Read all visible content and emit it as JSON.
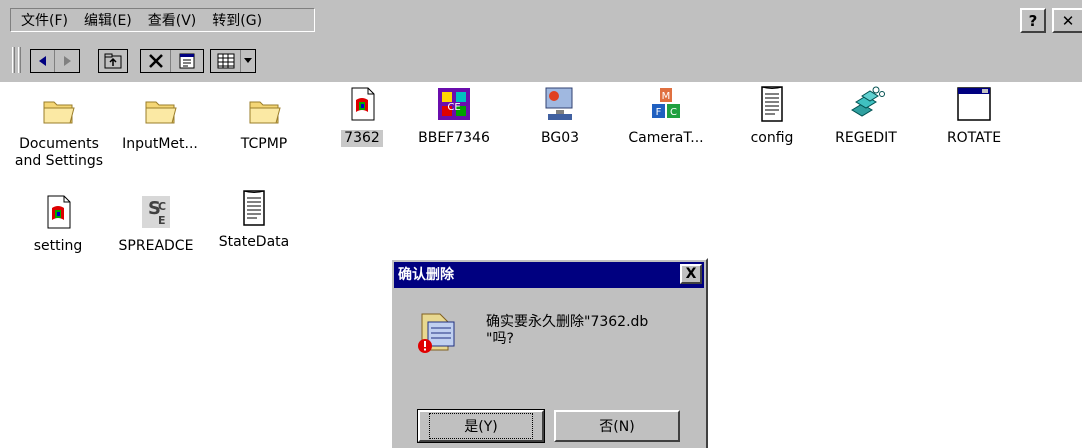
{
  "menubar": {
    "items": [
      "文件(F)",
      "编辑(E)",
      "查看(V)",
      "转到(G)"
    ],
    "help_label": "?",
    "close_label": "✕"
  },
  "toolbar": {
    "buttons": [
      "back-icon",
      "forward-icon",
      "up-folder-icon",
      "delete-icon",
      "properties-icon",
      "view-menu-icon"
    ]
  },
  "icons": [
    {
      "label": "Documents and Settings",
      "icon": "folder-icon"
    },
    {
      "label": "InputMet...",
      "icon": "folder-icon"
    },
    {
      "label": "TCPMP",
      "icon": "folder-icon"
    },
    {
      "label": "7362",
      "icon": "file-icon",
      "selected": true
    },
    {
      "label": "BBEF7346",
      "icon": "app-icon"
    },
    {
      "label": "BG03",
      "icon": "app-icon"
    },
    {
      "label": "CameraT...",
      "icon": "app-icon"
    },
    {
      "label": "config",
      "icon": "text-file-icon"
    },
    {
      "label": "REGEDIT",
      "icon": "regedit-icon"
    },
    {
      "label": "ROTATE",
      "icon": "window-icon"
    },
    {
      "label": "setting",
      "icon": "file-icon"
    },
    {
      "label": "SPREADCE",
      "icon": "spreadsheet-icon"
    },
    {
      "label": "StateData",
      "icon": "text-file-icon"
    }
  ],
  "dialog": {
    "title": "确认删除",
    "close_label": "X",
    "message": "确实要永久删除\"7362.db\"吗?",
    "message_line1": "确实要永久删除\"7362.db",
    "message_line2": "\"吗?",
    "yes_label": "是(Y)",
    "no_label": "否(N)"
  },
  "colors": {
    "chrome": "#c0c0c0",
    "title_bar": "#000080",
    "folder": "#f4d676"
  }
}
